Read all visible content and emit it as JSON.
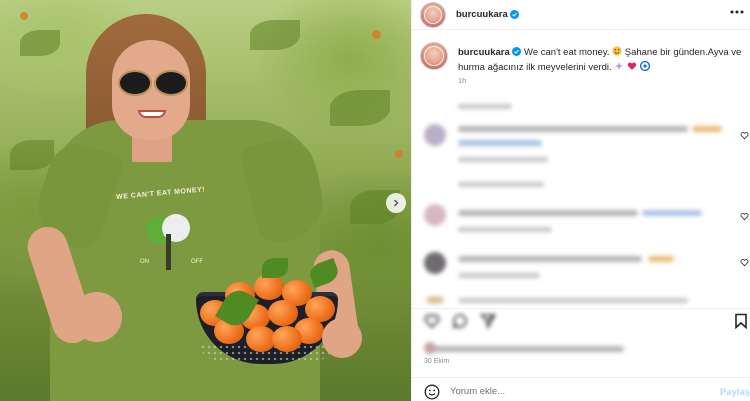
{
  "post": {
    "username": "burcuukara",
    "caption_text": "We can't eat money.",
    "caption_text2": "Şahane bir günden.Ayva ve hurma ağacınız ilk meyvelerini verdi.",
    "time_ago": "1h",
    "date": "30 Ekim",
    "comment_placeholder": "Yorum ekle...",
    "post_label": "Paylaş"
  },
  "photo": {
    "shirt_slogan": "WE CAN'T EAT MONEY!",
    "shirt_on": "ON",
    "shirt_off": "OFF"
  },
  "colors": {
    "verified": "#0095f6",
    "link": "#00376b",
    "muted": "#8e8e8e"
  },
  "icons": [
    "heart-icon",
    "comment-icon",
    "share-icon",
    "bookmark-icon",
    "emoji-icon",
    "verified-icon",
    "more-icon",
    "chevron-right-icon"
  ]
}
